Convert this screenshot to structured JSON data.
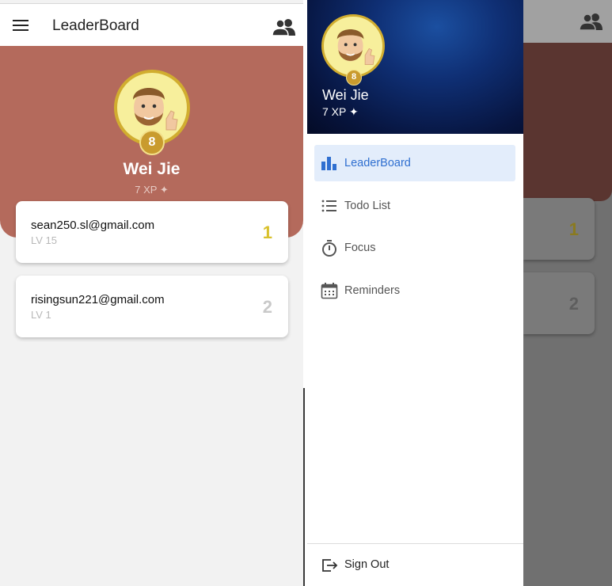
{
  "colors": {
    "accent": "#2f6fd0",
    "hero_bg": "#b46a5c",
    "rank_gold": "#d9c12c",
    "rank_silver": "#c9c9c9",
    "level_badge": "#c99b2e"
  },
  "appbar": {
    "title": "LeaderBoard",
    "menu_icon": "hamburger-menu-icon",
    "action_icon": "group-icon"
  },
  "profile": {
    "name": "Wei Jie",
    "level": "8",
    "xp": "7 XP",
    "xp_icon": "sparkle-icon"
  },
  "leaderboard": [
    {
      "email": "sean250.sl@gmail.com",
      "level": "LV 15",
      "rank": "1"
    },
    {
      "email": "risingsun221@gmail.com",
      "level": "LV 1",
      "rank": "2"
    }
  ],
  "drawer": {
    "name": "Wei Jie",
    "level": "8",
    "xp": "7 XP",
    "items": [
      {
        "label": "LeaderBoard",
        "icon": "bar-chart-icon",
        "active": true
      },
      {
        "label": "Todo List",
        "icon": "list-icon",
        "active": false
      },
      {
        "label": "Focus",
        "icon": "stopwatch-icon",
        "active": false
      },
      {
        "label": "Reminders",
        "icon": "calendar-icon",
        "active": false
      }
    ],
    "sign_out": {
      "label": "Sign Out",
      "icon": "logout-icon"
    }
  },
  "background_ranks": [
    "1",
    "2"
  ]
}
